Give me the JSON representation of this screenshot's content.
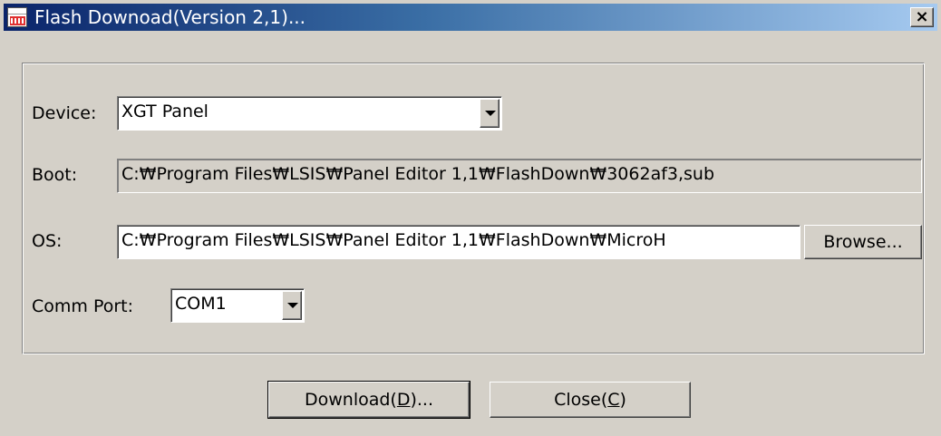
{
  "window": {
    "title": "Flash Downoad(Version 2,1)...",
    "close_label": "×"
  },
  "form": {
    "device_label": "Device:",
    "device_value": "XGT Panel",
    "boot_label": "Boot:",
    "boot_value": "C:₩Program Files₩LSIS₩Panel Editor 1,1₩FlashDown₩3062af3,sub",
    "os_label": "OS:",
    "os_value": "C:₩Program Files₩LSIS₩Panel Editor 1,1₩FlashDown₩MicroH",
    "browse_label": "Browse...",
    "comm_port_label": "Comm Port:",
    "comm_port_value": "COM1"
  },
  "buttons": {
    "download_prefix": "Download(",
    "download_mnemonic": "D",
    "download_suffix": ")...",
    "close_prefix": "Close(",
    "close_mnemonic": "C",
    "close_suffix": ")"
  },
  "icons": {
    "app": "flash-download-app-icon",
    "close": "close-icon",
    "dropdown": "dropdown-arrow-icon"
  },
  "colors": {
    "face": "#d4d0c8",
    "title_start": "#0a246a",
    "title_end": "#a6caf0"
  }
}
